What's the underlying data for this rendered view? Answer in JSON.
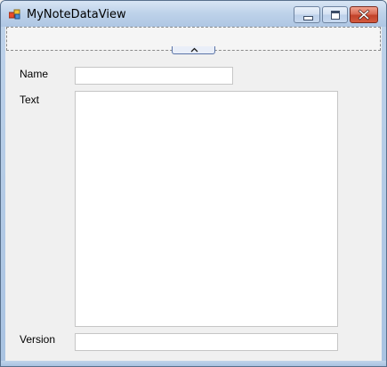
{
  "window": {
    "title": "MyNoteDataView",
    "icon": "app-form-icon",
    "controls": [
      "minimize-icon",
      "maximize-icon",
      "close-icon"
    ]
  },
  "form": {
    "name_label": "Name",
    "name_value": "",
    "text_label": "Text",
    "text_value": "",
    "version_label": "Version",
    "version_value": ""
  },
  "panel": {
    "collapse_icon": "chevron-up-icon"
  },
  "colors": {
    "titlebar": "#bfd3ea",
    "close_button": "#c2422a",
    "background": "#f0f0f0"
  }
}
